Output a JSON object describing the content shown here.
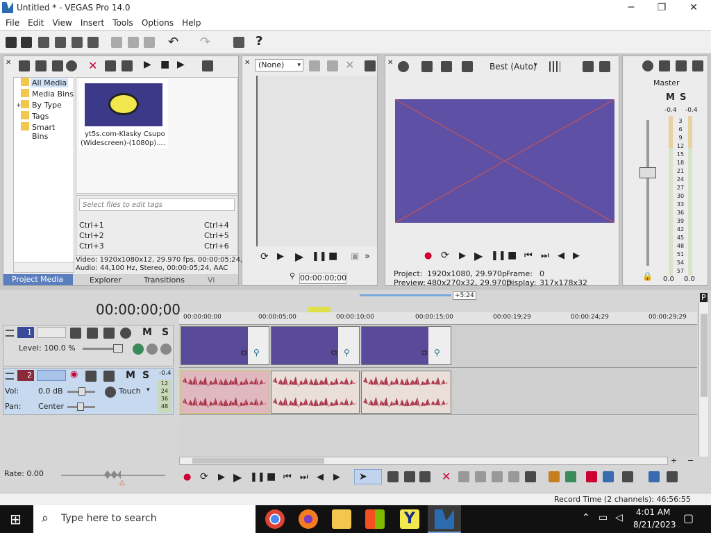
{
  "window": {
    "title": "Untitled * - VEGAS Pro 14.0",
    "minimize": "─",
    "maximize": "❐",
    "close": "✕"
  },
  "menu": [
    "File",
    "Edit",
    "View",
    "Insert",
    "Tools",
    "Options",
    "Help"
  ],
  "media_panel": {
    "tree": [
      "All Media",
      "Media Bins",
      "By Type",
      "Tags",
      "Smart Bins"
    ],
    "thumbnail_label_1": "yt5s.com-Klasky Csupo",
    "thumbnail_label_2": "(Widescreen)-(1080p)....",
    "tag_placeholder": "Select files to edit tags",
    "shortcuts": [
      "Ctrl+1",
      "Ctrl+4",
      "Ctrl+2",
      "Ctrl+5",
      "Ctrl+3",
      "Ctrl+6"
    ],
    "info_video": "Video: 1920x1080x12, 29.970 fps, 00:00:05;24,",
    "info_audio": "Audio: 44,100 Hz, Stereo, 00:00:05;24, AAC",
    "tabs": [
      "Project Media",
      "Explorer",
      "Transitions",
      "Vi"
    ]
  },
  "trimmer": {
    "select_value": "(None)",
    "timecode": "00:00:00;00"
  },
  "preview": {
    "quality": "Best (Auto)",
    "project_label": "Project:",
    "project_value": "1920x1080, 29.970p",
    "frame_label": "Frame:",
    "frame_value": "0",
    "preview_label": "Preview:",
    "preview_value": "480x270x32, 29.970p",
    "display_label": "Display:",
    "display_value": "317x178x32"
  },
  "master": {
    "title": "Master",
    "peak_left": "-0.4",
    "peak_right": "-0.4",
    "scale": [
      "3",
      "6",
      "9",
      "12",
      "15",
      "18",
      "21",
      "24",
      "27",
      "30",
      "33",
      "36",
      "39",
      "42",
      "45",
      "48",
      "51",
      "54",
      "57"
    ],
    "bottom_left": "0.0",
    "bottom_right": "0.0"
  },
  "timeline": {
    "timecode": "00:00:00;00",
    "loop_len": "+5:24",
    "ruler": [
      "00:00:00;00",
      "00:00:05;00",
      "00:00:10;00",
      "00:00:15;00",
      "00:00:19;29",
      "00:00:24;29",
      "00:00:29;29"
    ],
    "video_track": {
      "number": "1",
      "level": "Level: 100.0 %"
    },
    "audio_track": {
      "number": "2",
      "vol_label": "Vol:",
      "vol_value": "0.0 dB",
      "pan_label": "Pan:",
      "pan_value": "Center",
      "touch": "Touch",
      "peak": "-0.4",
      "meter": [
        "12",
        "24",
        "36",
        "48"
      ]
    },
    "rate": "Rate: 0.00"
  },
  "statusbar": {
    "record_time": "Record Time (2 channels): 46:56:55"
  },
  "taskbar": {
    "search_placeholder": "Type here to search",
    "time": "4:01 AM",
    "date": "8/21/2023"
  }
}
